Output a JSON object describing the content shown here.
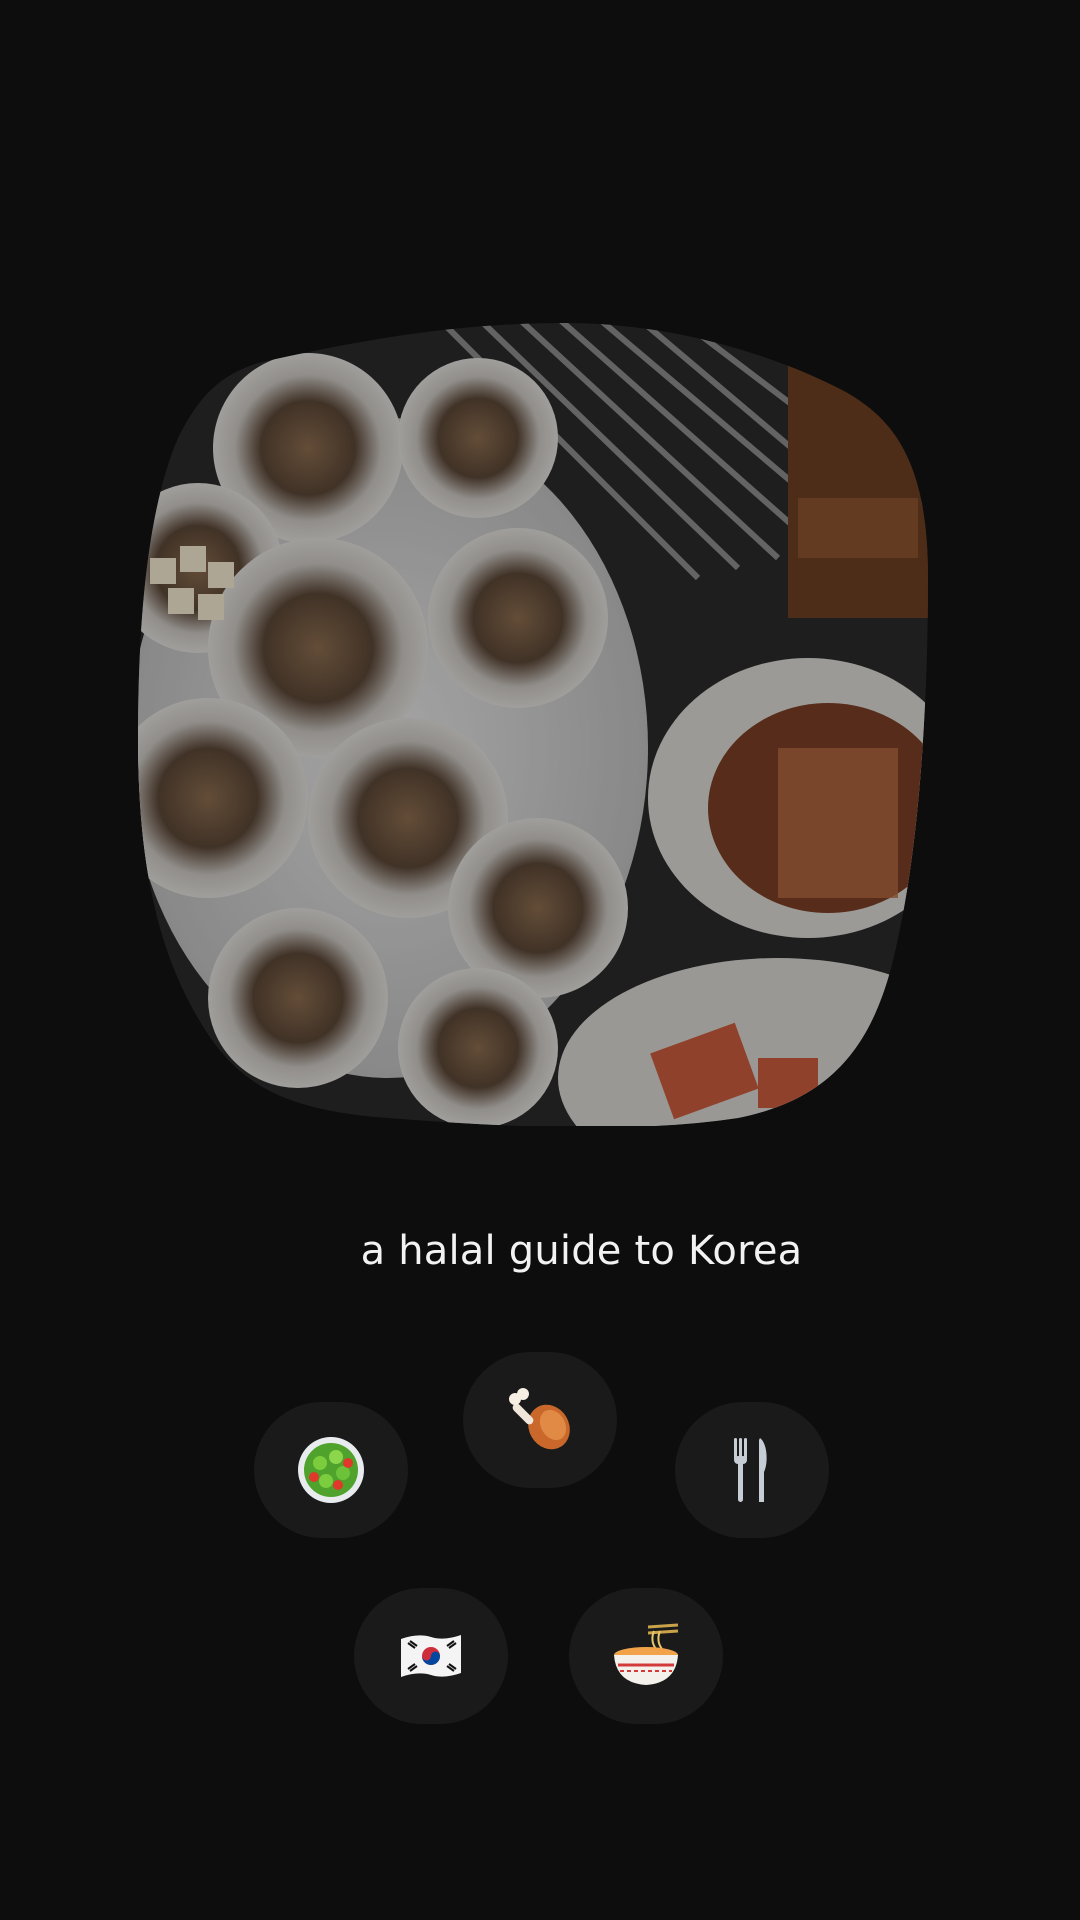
{
  "app": {
    "title": "a halal guide to Korea"
  },
  "hero": {
    "image_subject": "grilled-scallops-korean-bbq"
  },
  "categories": [
    {
      "id": "salad",
      "icon": "salad-bowl-icon"
    },
    {
      "id": "chicken",
      "icon": "chicken-leg-icon"
    },
    {
      "id": "cutlery",
      "icon": "fork-knife-icon"
    },
    {
      "id": "korea",
      "icon": "korea-flag-icon"
    },
    {
      "id": "noodles",
      "icon": "noodle-bowl-icon"
    }
  ],
  "colors": {
    "background": "#0d0d0e",
    "chip": "#1a1a1b",
    "text": "#f2f2f2"
  }
}
